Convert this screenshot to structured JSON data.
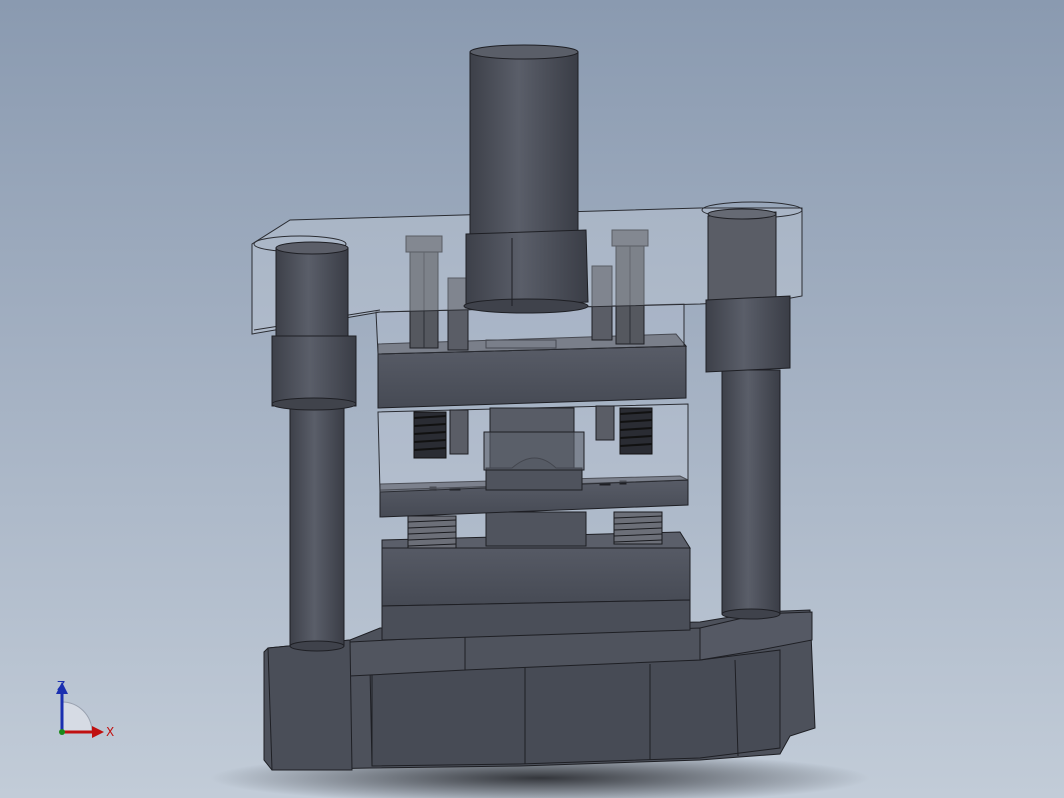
{
  "viewport": {
    "background_top": "#8a9ab0",
    "background_bottom": "#c2ccd8"
  },
  "model": {
    "solid_color": "#4b4e59",
    "edge_color": "#1e1f24",
    "transparent_color": "#b8c2d0"
  },
  "triad": {
    "z_label": "Z",
    "x_label": "X",
    "z_color": "#1a2fb0",
    "x_color": "#c01010",
    "y_color": "#1a8a1a"
  }
}
